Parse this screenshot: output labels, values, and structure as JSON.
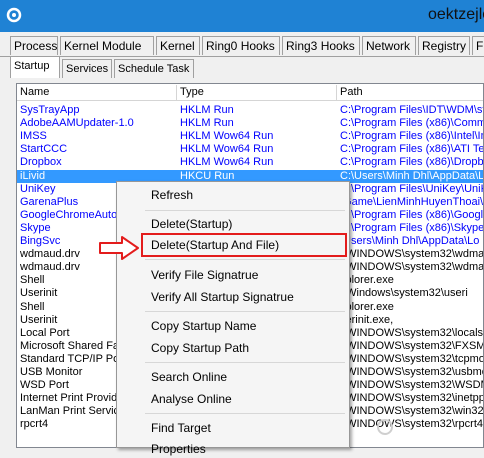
{
  "window": {
    "title": "oektzejlo"
  },
  "main_tabs": [
    "Process",
    "Kernel Module",
    "Kernel",
    "Ring0 Hooks",
    "Ring3 Hooks",
    "Network",
    "Registry",
    "Fi"
  ],
  "sub_tabs": [
    "Startup",
    "Services",
    "Schedule Task"
  ],
  "columns": [
    "Name",
    "Type",
    "Path"
  ],
  "rows": [
    {
      "name": "SysTrayApp",
      "type": "HKLM Run",
      "path": "C:\\Program Files\\IDT\\WDM\\st",
      "blue": true
    },
    {
      "name": "AdobeAAMUpdater-1.0",
      "type": "HKLM Run",
      "path": "C:\\Program Files (x86)\\Commo",
      "blue": true
    },
    {
      "name": "IMSS",
      "type": "HKLM Wow64 Run",
      "path": "C:\\Program Files (x86)\\Intel\\In",
      "blue": true
    },
    {
      "name": "StartCCC",
      "type": "HKLM Wow64 Run",
      "path": "C:\\Program Files (x86)\\ATI Te",
      "blue": true
    },
    {
      "name": "Dropbox",
      "type": "HKLM Wow64 Run",
      "path": "C:\\Program Files (x86)\\Dropbo",
      "blue": true
    },
    {
      "name": "iLivid",
      "type": "HKCU Run",
      "path": "C:\\Users\\Minh Dhl\\AppData\\Lo",
      "blue": true,
      "selected": true
    },
    {
      "name": "UniKey",
      "type": "",
      "path": "C:\\Program Files\\UniKey\\UniKe",
      "blue": true
    },
    {
      "name": "GarenaPlus",
      "type": "",
      "path": "\\Game\\LienMinhHuyenThoai\\",
      "blue": true
    },
    {
      "name": "GoogleChromeAutoL",
      "type": "",
      "path": "C:\\Program Files (x86)\\Google",
      "blue": true
    },
    {
      "name": "Skype",
      "type": "",
      "path": "C:\\Program Files (x86)\\Skype\\",
      "blue": true
    },
    {
      "name": "BingSvc",
      "type": "",
      "path": "\\Users\\Minh Dhl\\AppData\\Lo",
      "blue": true
    },
    {
      "name": "wdmaud.drv",
      "type": "",
      "path": ":\\WINDOWS\\system32\\wdma",
      "blue": false
    },
    {
      "name": "wdmaud.drv",
      "type": "",
      "path": ":\\WINDOWS\\system32\\wdma",
      "blue": false
    },
    {
      "name": "Shell",
      "type": "",
      "path": "xplorer.exe",
      "blue": false
    },
    {
      "name": "Userinit",
      "type": "",
      "path": ":\\Windows\\system32\\useri",
      "blue": false
    },
    {
      "name": "Shell",
      "type": "",
      "path": "xplorer.exe",
      "blue": false
    },
    {
      "name": "Userinit",
      "type": "",
      "path": "serinit.exe,",
      "blue": false
    },
    {
      "name": "Local Port",
      "type": "",
      "path": ":\\WINDOWS\\system32\\localsp",
      "blue": false
    },
    {
      "name": "Microsoft Shared Fa",
      "type": "",
      "path": ":\\WINDOWS\\system32\\FXSMO",
      "blue": false
    },
    {
      "name": "Standard TCP/IP Por",
      "type": "",
      "path": ":\\WINDOWS\\system32\\tcpmo",
      "blue": false
    },
    {
      "name": "USB Monitor",
      "type": "",
      "path": ":\\WINDOWS\\system32\\usbmo",
      "blue": false
    },
    {
      "name": "WSD Port",
      "type": "",
      "path": ":\\WINDOWS\\system32\\WSDMo",
      "blue": false
    },
    {
      "name": "Internet Print Provid",
      "type": "",
      "path": ":\\WINDOWS\\system32\\inetpp",
      "blue": false
    },
    {
      "name": "LanMan Print Service",
      "type": "",
      "path": ":\\WINDOWS\\system32\\win32s",
      "blue": false
    },
    {
      "name": "rpcrt4",
      "type": "",
      "path": ":\\WINDOWS\\system32\\rpcrt4",
      "blue": false
    }
  ],
  "context_menu": {
    "items": [
      "Refresh",
      "Delete(Startup)",
      "Delete(Startup And File)",
      "Verify File Signatrue",
      "Verify All Startup Signatrue",
      "Copy Startup Name",
      "Copy Startup Path",
      "Search Online",
      "Analyse Online",
      "Find Target",
      "Properties"
    ]
  },
  "colors": {
    "titlebar": "#1f82d4",
    "selection": "#3399ff",
    "link_blue": "#0000ff",
    "highlight": "#e31c1c"
  }
}
